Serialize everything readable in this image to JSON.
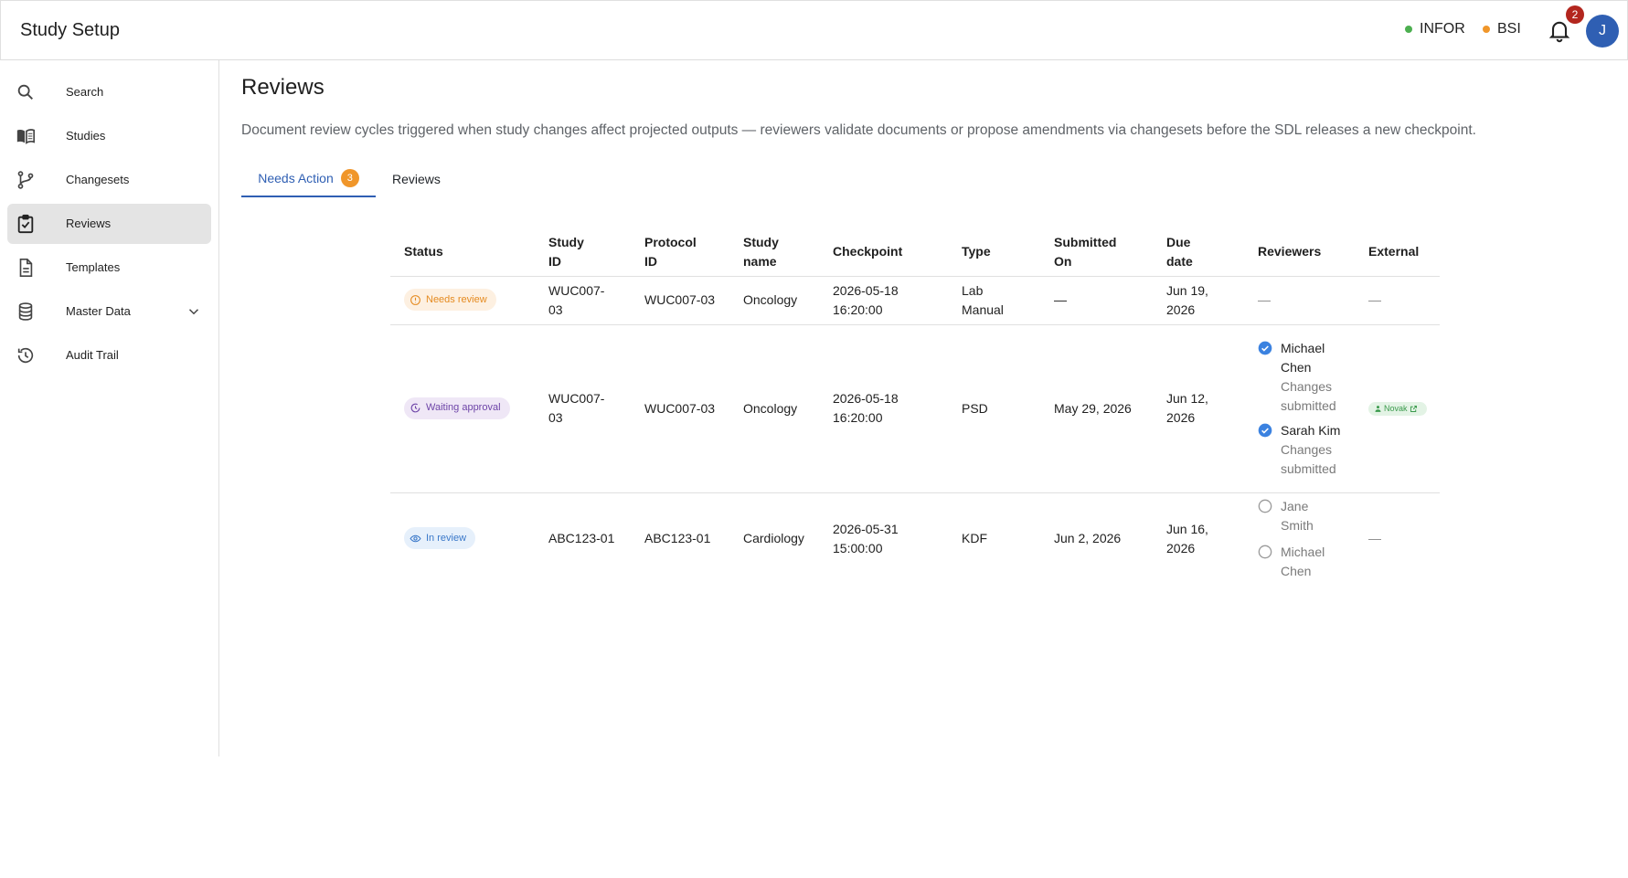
{
  "app": {
    "title": "Study Setup"
  },
  "header": {
    "environments": [
      {
        "label": "INFOR",
        "color": "#4caf50"
      },
      {
        "label": "BSI",
        "color": "#f0962a"
      }
    ],
    "notifications_count": "2",
    "avatar_initial": "J"
  },
  "sidebar": {
    "items": [
      {
        "label": "Search",
        "icon": "search-icon"
      },
      {
        "label": "Studies",
        "icon": "book-icon"
      },
      {
        "label": "Changesets",
        "icon": "branch-icon"
      },
      {
        "label": "Reviews",
        "icon": "clipboard-check-icon",
        "active": true
      },
      {
        "label": "Templates",
        "icon": "document-icon"
      },
      {
        "label": "Master Data",
        "icon": "database-icon",
        "expandable": true
      },
      {
        "label": "Audit Trail",
        "icon": "history-icon"
      }
    ]
  },
  "page": {
    "title": "Reviews",
    "description": "Document review cycles triggered when study changes affect projected outputs — reviewers validate documents or propose amendments via changesets before the SDL releases a new checkpoint."
  },
  "tabs": [
    {
      "label": "Needs Action",
      "badge": "3",
      "active": true
    },
    {
      "label": "Reviews"
    }
  ],
  "table": {
    "headers": {
      "status": "Status",
      "study_id": "Study ID",
      "protocol_id": "Protocol ID",
      "study_name": "Study name",
      "checkpoint": "Checkpoint",
      "type": "Type",
      "submitted_on": "Submitted On",
      "due_date": "Due date",
      "reviewers": "Reviewers",
      "external": "External"
    },
    "rows": [
      {
        "status": "Needs review",
        "study_id": "WUC007-03",
        "protocol_id": "WUC007-03",
        "study_name": "Oncology",
        "checkpoint": "2026-05-18 16:20:00",
        "type": "Lab Manual",
        "submitted_on": "—",
        "due_date": "Jun 19, 2026",
        "reviewers_empty": "—",
        "external": "—"
      },
      {
        "status": "Waiting approval",
        "study_id": "WUC007-03",
        "protocol_id": "WUC007-03",
        "study_name": "Oncology",
        "checkpoint": "2026-05-18 16:20:00",
        "type": "PSD",
        "submitted_on": "May 29, 2026",
        "due_date": "Jun 12, 2026",
        "reviewers": [
          {
            "name": "Michael Chen",
            "status": "Changes submitted"
          },
          {
            "name": "Sarah Kim",
            "status": "Changes submitted"
          }
        ],
        "external": "Novak"
      },
      {
        "status": "In review",
        "study_id": "ABC123-01",
        "protocol_id": "ABC123-01",
        "study_name": "Cardiology",
        "checkpoint": "2026-05-31 15:00:00",
        "type": "KDF",
        "submitted_on": "Jun 2, 2026",
        "due_date": "Jun 16, 2026",
        "reviewers": [
          {
            "name": "Jane Smith"
          },
          {
            "name": "Michael Chen"
          }
        ],
        "external": "—"
      }
    ]
  }
}
